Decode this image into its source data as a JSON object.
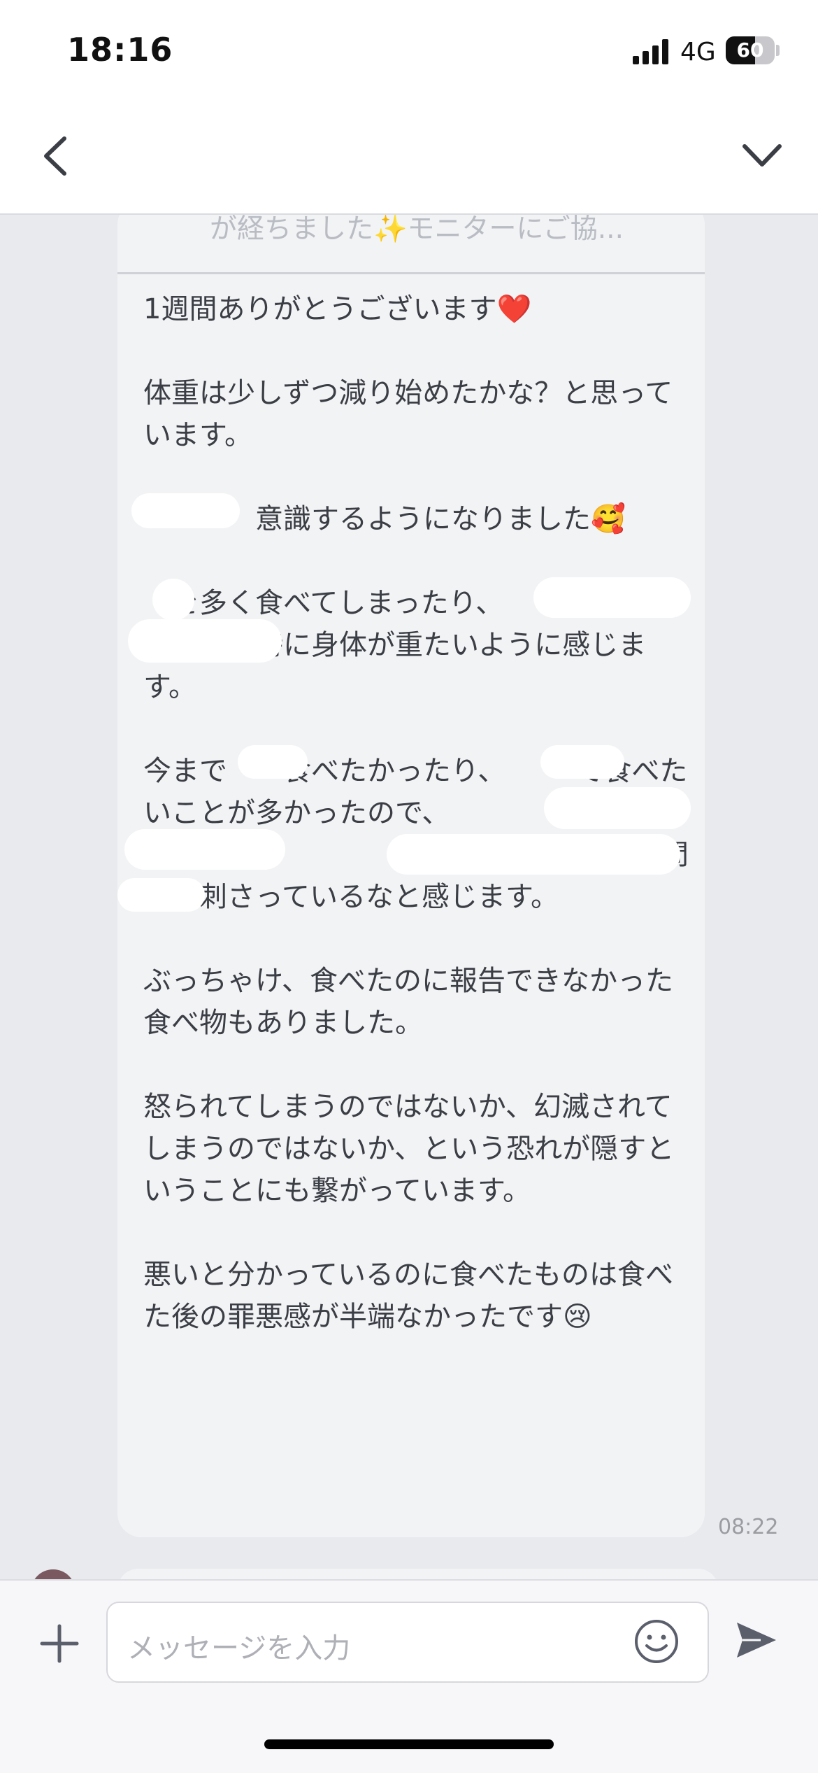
{
  "status_bar": {
    "time": "18:16",
    "network": "4G",
    "battery": "60",
    "battery_level": 0.6
  },
  "nav": {
    "back_icon": "chevron-left-icon",
    "collapse_icon": "chevron-down-icon"
  },
  "message": {
    "quote_text": "が経ちました✨モニターにご協...",
    "body": "1週間ありがとうございます❤️\n\n体重は少しずつ減り始めたかな？と思っています。\n\n　　　　意識するようになりました🥰\n\n　を多く食べてしまったり、　　　　　　　　　を食べた時に身体が重たいように感じます。\n\n今まで　　食べたかったり、　　　で食べたいことが多かったので、　　　　　　　　　　　？」「　　　　　　　　　　　　」という問いが刺さっているなと感じます。\n\nぶっちゃけ、食べたのに報告できなかった食べ物もありました。\n\n怒られてしまうのではないか、幻滅されてしまうのではないか、という恐れが隠すということにも繋がっています。\n\n悪いと分かっているのに食べたものは食べた後の罪悪感が半端なかったです😢",
    "timestamp": "08:22"
  },
  "input_bar": {
    "plus_icon": "plus-icon",
    "placeholder": "メッセージを入力",
    "emoji_icon": "smiley-icon",
    "send_icon": "send-icon"
  },
  "colors": {
    "bubble": "#f2f3f5",
    "background": "#e9eaee",
    "text": "#3b3e45"
  }
}
